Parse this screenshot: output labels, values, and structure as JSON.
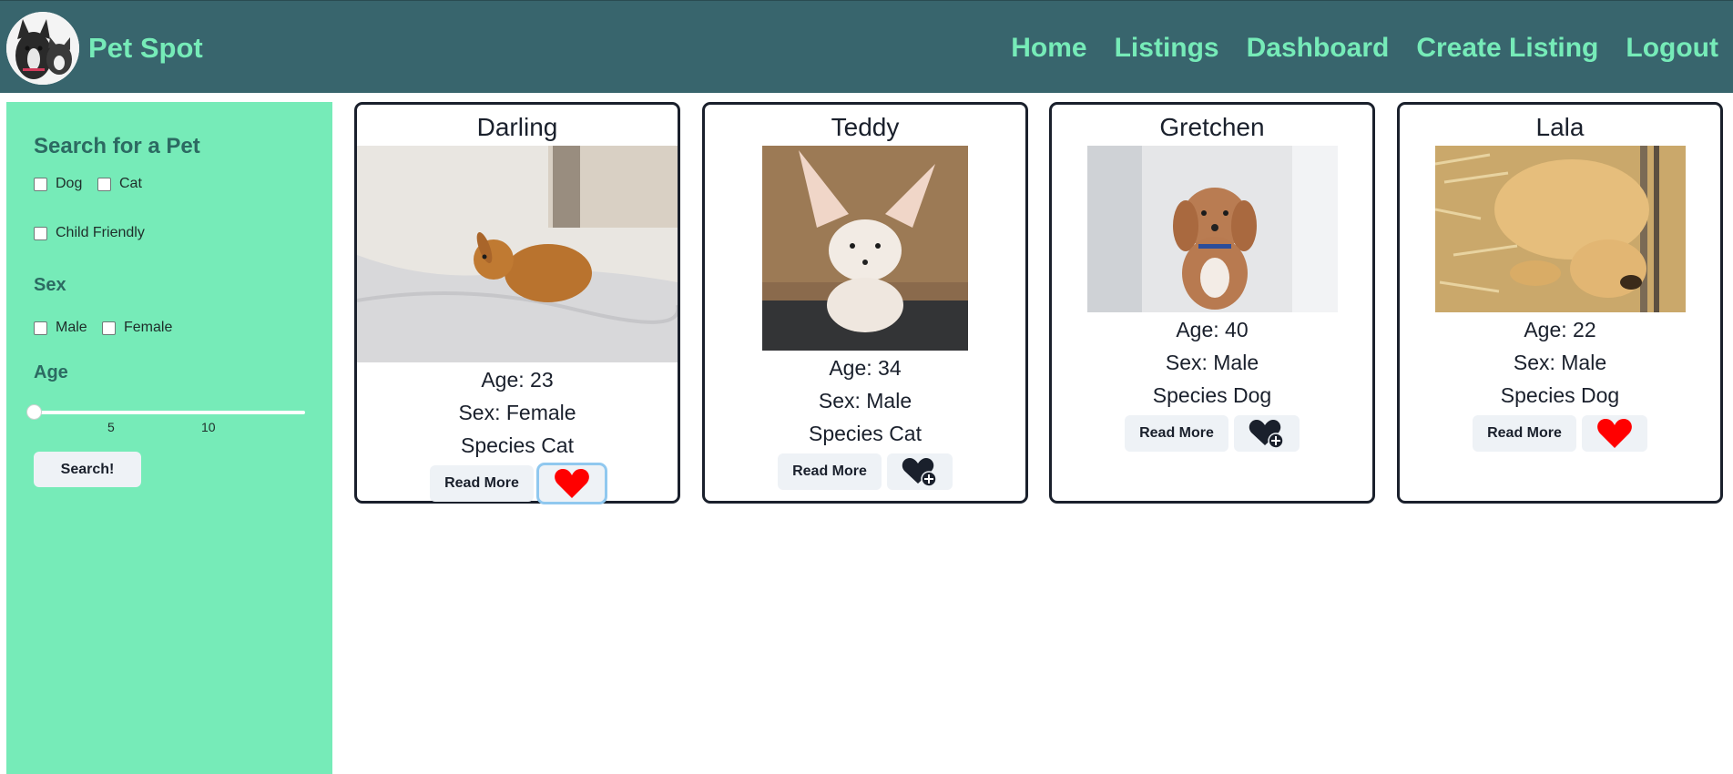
{
  "header": {
    "brand": "Pet Spot",
    "nav": [
      "Home",
      "Listings",
      "Dashboard",
      "Create Listing",
      "Logout"
    ]
  },
  "sidebar": {
    "title": "Search for a Pet",
    "species": [
      "Dog",
      "Cat"
    ],
    "child_friendly": "Child Friendly",
    "sex_title": "Sex",
    "sex_options": [
      "Male",
      "Female"
    ],
    "age_title": "Age",
    "age_ticks": [
      "5",
      "10"
    ],
    "age_value": 0,
    "search_label": "Search!"
  },
  "pets": [
    {
      "name": "Darling",
      "age": "Age: 23",
      "sex": "Sex: Female",
      "species": "Species Cat",
      "read_more": "Read More",
      "favorited": true
    },
    {
      "name": "Teddy",
      "age": "Age: 34",
      "sex": "Sex: Male",
      "species": "Species Cat",
      "read_more": "Read More",
      "favorited": false
    },
    {
      "name": "Gretchen",
      "age": "Age: 40",
      "sex": "Sex: Male",
      "species": "Species Dog",
      "read_more": "Read More",
      "favorited": false
    },
    {
      "name": "Lala",
      "age": "Age: 22",
      "sex": "Sex: Male",
      "species": "Species Dog",
      "read_more": "Read More",
      "favorited": true
    }
  ],
  "colors": {
    "header_bg": "#38656d",
    "accent": "#76ebb8",
    "heart_red": "#ff0000"
  }
}
